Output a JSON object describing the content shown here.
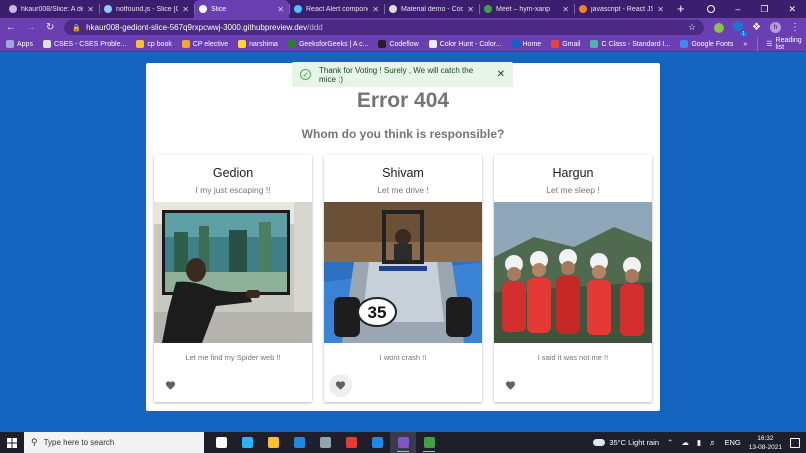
{
  "browser": {
    "tabs": [
      {
        "label": "hkaur008/Slice: A deve",
        "fav": "#c9b8e8",
        "active": false
      },
      {
        "label": "notfound.js - Slice [G",
        "fav": "#90caf9",
        "active": false
      },
      {
        "label": "Slice",
        "fav": "#ffffff",
        "active": true
      },
      {
        "label": "React Alert componen",
        "fav": "#4fc3f7",
        "active": false
      },
      {
        "label": "Material demo - Code",
        "fav": "#e0e0e0",
        "active": false
      },
      {
        "label": "Meet – hym-xanp",
        "fav": "#43a047",
        "active": false
      },
      {
        "label": "javascript - React JS o",
        "fav": "#f48024",
        "active": false
      }
    ],
    "new_tab": "+",
    "window_controls": {
      "minimize": "–",
      "restore": "❐",
      "close": "✕"
    },
    "address": {
      "host": "hkaur008-gediont-slice-567q9rxpcwwj-3000.githubpreview.dev",
      "path": "/ddd"
    },
    "avatar_letter": "h",
    "extension_badge": "1",
    "bookmarks": [
      {
        "label": "Apps",
        "color": "#9fa8da"
      },
      {
        "label": "CSES - CSES Proble...",
        "color": "#e0e0e0"
      },
      {
        "label": "cp book",
        "color": "#fbc02d"
      },
      {
        "label": "CP elective",
        "color": "#f9a825"
      },
      {
        "label": "narshima",
        "color": "#fdd835"
      },
      {
        "label": "GeeksforGeeks | A c...",
        "color": "#2e7d32"
      },
      {
        "label": "Codeflow",
        "color": "#212121"
      },
      {
        "label": "Color Hunt - Color...",
        "color": "#eeeeee"
      },
      {
        "label": "Home",
        "color": "#0a66c2"
      },
      {
        "label": "Gmail",
        "color": "#ea4335"
      },
      {
        "label": "C Class - Standard I...",
        "color": "#4db6ac"
      },
      {
        "label": "Google Fonts",
        "color": "#4285f4"
      }
    ],
    "bookmarks_more": "»",
    "reading_list": "Reading list"
  },
  "toast": {
    "message": "Thank for Voting ! Surely , We will catch the mice :)"
  },
  "main": {
    "title": "Error 404",
    "question": "Whom do you think is responsible?"
  },
  "cards": [
    {
      "name": "Gedion",
      "subtitle": "I my just escaping !!",
      "quote": "Let me find my Spider web !!"
    },
    {
      "name": "Shivam",
      "subtitle": "Let me drive !",
      "quote": "I wont crash !!"
    },
    {
      "name": "Hargun",
      "subtitle": "Let me sleep !",
      "quote": "I said it was not me !!"
    }
  ],
  "kart_number": "35",
  "colors": {
    "page_bg": "#1565c0",
    "browser": "#6a3fb2",
    "heart": "#616161",
    "toast_bg": "#e6f4ea"
  },
  "taskbar": {
    "search_placeholder": "Type here to search",
    "apps": [
      {
        "name": "task-view",
        "color": "#ffffff"
      },
      {
        "name": "edge",
        "color": "#29b6f6"
      },
      {
        "name": "file-explorer",
        "color": "#fbc02d"
      },
      {
        "name": "mail",
        "color": "#1e88e5"
      },
      {
        "name": "store",
        "color": "#90a4ae"
      },
      {
        "name": "opera",
        "color": "#e53935"
      },
      {
        "name": "vscode",
        "color": "#1e88e5"
      },
      {
        "name": "chrome",
        "color": "#7e57c2"
      },
      {
        "name": "terminal",
        "color": "#43a047"
      }
    ],
    "weather": "35°C  Light rain",
    "language": "ENG",
    "time": "16:32",
    "date": "13-08-2021"
  }
}
